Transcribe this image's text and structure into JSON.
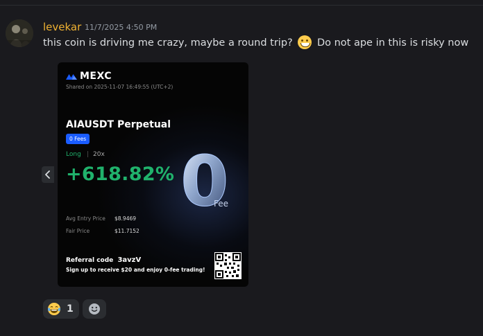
{
  "message": {
    "author": "levekar",
    "timestamp": "11/7/2025 4:50 PM",
    "text_before_emoji": "this coin is driving me crazy, maybe a round trip?",
    "emoji": "smile-emoji",
    "text_after_emoji": "Do not ape in this is risky now"
  },
  "card": {
    "brand": "MEXC",
    "shared_on": "Shared on 2025-11-07 16:49:55 (UTC+2)",
    "pair": "AIAUSDT Perpetual",
    "fees_badge": "0 Fees",
    "side": "Long",
    "leverage_separator": "|",
    "leverage": "20x",
    "pnl": "+618.82%",
    "zero_digit": "0",
    "zero_label": "Fee",
    "rows": [
      {
        "label": "Avg Entry Price",
        "value": "$8.9469"
      },
      {
        "label": "Fair Price",
        "value": "$11.7152"
      }
    ],
    "referral_label": "Referral code",
    "referral_code": "3avzV",
    "referral_sub": "Sign up to receive $20 and enjoy 0-fee trading!",
    "accent_green": "#20b26c",
    "accent_blue": "#1a5cff"
  },
  "reactions": [
    {
      "emoji": "laughing-tears-emoji",
      "count": "1"
    }
  ],
  "colors": {
    "background": "#1a1a1e",
    "username": "#f0b232",
    "timestamp": "#949ba4"
  }
}
